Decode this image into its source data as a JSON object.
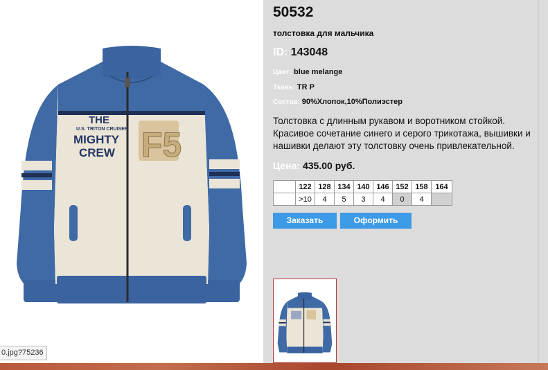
{
  "product": {
    "code": "50532",
    "subtitle": "толстовка для мальчика",
    "id_label": "ID:",
    "id_value": "143048",
    "attributes": [
      {
        "label": "Цвет:",
        "value": "blue melange"
      },
      {
        "label": "Ткань:",
        "value": "TR P"
      },
      {
        "label": "Состав:",
        "value": "90%Хлопок,10%Полиэстер"
      }
    ],
    "description": "Толстовка с длинным рукавом и воротником стойкой. Красивое сочетание синего и серого трикотажа, вышивки и нашивки делают эту толстовку очень привлекательной.",
    "price_label": "Цена:",
    "price_value": "435.00 руб."
  },
  "sizes": {
    "headers": [
      "122",
      "128",
      "134",
      "140",
      "146",
      "152",
      "158",
      "164"
    ],
    "stock": [
      ">10",
      "4",
      "5",
      "3",
      "4",
      "0",
      "4",
      ""
    ]
  },
  "buttons": {
    "order": "Заказать",
    "checkout": "Оформить"
  },
  "image": {
    "patch_lines": [
      "U.S. TRITON CRUISER",
      "THE",
      "MIGHTY",
      "CREW"
    ],
    "patch_number": "F5",
    "url_tooltip": "0.jpg?75236"
  },
  "colors": {
    "panel_bg": "#dcdcdc",
    "button_blue": "#3d9ae6",
    "jacket_blue": "#3f6aa6",
    "jacket_grey": "#ebe5d8",
    "thumb_border": "#b33b3b"
  }
}
